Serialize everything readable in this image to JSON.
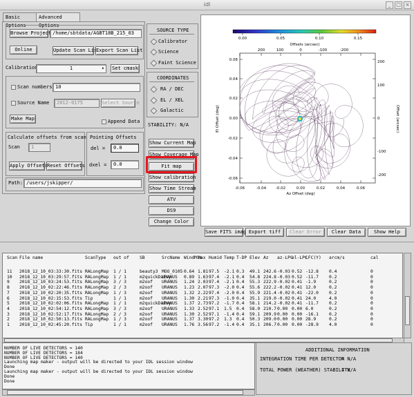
{
  "window": {
    "title": "idl"
  },
  "tabs": [
    {
      "label": "Basic Options"
    },
    {
      "label": "Advanced Options"
    }
  ],
  "top_panel": {
    "browse_projects": "Browse Projects",
    "project_path": "/home/sbtdata/AGBT18B_215_03",
    "online": "Online",
    "update_scan_list": "Update Scan List",
    "export_scan_list": "Export Scan List"
  },
  "calibration": {
    "label": "Calibration",
    "value": "1",
    "set_cmask": "Set cmask"
  },
  "scan_numbers": {
    "label": "Scan numbers",
    "value": "10"
  },
  "source_name": {
    "label": "Source Name",
    "value": "2012-0175",
    "select_button": "Select Source"
  },
  "make_map": "Make Map",
  "append_data": "Append Data",
  "offsets": {
    "calc_title": "Calculate offsets from scan",
    "scan_label": "Scan",
    "scan_value": "1",
    "apply": "Apply Offsets",
    "reset": "Reset Offsets",
    "pointing_title": "Pointing Offsets",
    "del_label": "del =",
    "del_value": "0.0",
    "dxel_label": "dxel =",
    "dxel_value": "0.0"
  },
  "path": {
    "label": "Path:",
    "value": "/users/jskipper/"
  },
  "source_type": {
    "title": "SOURCE TYPE",
    "options": [
      "Calibrator",
      "Science",
      "Faint Science"
    ]
  },
  "coordinates": {
    "title": "COORDINATES",
    "options": [
      "RA / DEC",
      "EL / XEL",
      "Galactic"
    ]
  },
  "stability": "STABILITY:  N/A",
  "right_buttons": [
    "Show Current Map",
    "Show Coverage Map",
    "Fit map",
    "Show calibration",
    "Show Time Stream",
    "ATV",
    "DS9",
    "Change Color"
  ],
  "plot": {
    "colorbar_ticks": [
      "0.00",
      "0.05",
      "0.10",
      "0.15"
    ],
    "top_axis_label": "Offsets (arcsec)",
    "top_ticks": [
      "200",
      "100",
      "0",
      "-100",
      "-200"
    ],
    "bottom_axis_label": "Az Offset (deg)",
    "bottom_ticks": [
      "-0.06",
      "-0.04",
      "-0.02",
      "0.00",
      "0.02",
      "0.04",
      "0.06"
    ],
    "left_axis_label": "El Offset (deg)",
    "left_ticks": [
      "0.06",
      "0.04",
      "0.02",
      "0.00",
      "-0.02",
      "-0.04",
      "-0.06"
    ],
    "right_axis_label": "Offset (arcsec)",
    "right_ticks": [
      "200",
      "100",
      "0",
      "-100",
      "-200"
    ],
    "colors": {
      "trace": "#3a1640",
      "center": "#f2e030",
      "center_ring": "#1eb4c8"
    }
  },
  "plot_buttons": [
    "Save FITS image",
    "Export tiff",
    "Clear Error",
    "Clear Data",
    "Show Help"
  ],
  "table": {
    "headers": [
      "Scan",
      "File name",
      "ScanType",
      "out of",
      "SB",
      "SrcName",
      "WindMin",
      "Max",
      "Humid",
      "Temp",
      "T-DP",
      "Elev",
      "Az",
      "az-LPC",
      "el-LPC",
      "LFC(Y)",
      "arcm/s",
      "cal"
    ],
    "rows": [
      [
        "11",
        "2018_12_10_03:33:30.fits",
        "RALongMap",
        "1 / 1",
        "beauty3",
        "MOO_0105",
        "0.64",
        "1.81",
        "97.5",
        "-2.1",
        "0.3",
        "49.1",
        "242.6",
        "-0.03",
        "0.52",
        "-12.8",
        "0.4",
        "0"
      ],
      [
        "10",
        "2018_12_10_03:29:57.fits",
        "RALongMap",
        "1 / 1",
        "m2quickDaisy",
        "URANUS",
        "0.89",
        "1.63",
        "97.4",
        "-2.1",
        "0.4",
        "54.8",
        "224.8",
        "-0.03",
        "0.52",
        "-11.7",
        "0.2",
        "0"
      ],
      [
        "9",
        "2018_12_10_03:24:53.fits",
        "RALongMap",
        "3 / 3",
        "m2oof",
        "URANUS",
        "1.24",
        "2.03",
        "97.4",
        "-2.1",
        "0.4",
        "55.3",
        "222.9",
        "-0.02",
        "0.41",
        "-1.9",
        "0.2",
        "0"
      ],
      [
        "8",
        "2018_12_10_02:22:46.fits",
        "RALongMap",
        "2 / 3",
        "m2oof",
        "URANUS",
        "1.23",
        "2.07",
        "97.3",
        "-2.0",
        "0.4",
        "55.6",
        "222.2",
        "-0.02",
        "0.41",
        "12.0",
        "0.2",
        "0"
      ],
      [
        "7",
        "2018_12_10_02:20:35.fits",
        "RALongMap",
        "1 / 3",
        "m2oof",
        "URANUS",
        "1.32",
        "2.22",
        "97.4",
        "-2.0",
        "0.4",
        "55.9",
        "221.4",
        "-0.02",
        "0.41",
        "-22.0",
        "0.2",
        "0"
      ],
      [
        "6",
        "2018_12_10_02:15:53.fits",
        "Tip",
        "1 / 1",
        "m2oof",
        "URANUS",
        "1.30",
        "2.21",
        "97.3",
        "-1.0",
        "0.4",
        "35.1",
        "219.0",
        "-0.02",
        "0.41",
        "24.0",
        "4.0",
        "0"
      ],
      [
        "5",
        "2018_12_10_02:02:06.fits",
        "RALongMap",
        "1 / 1",
        "m2quickDaisy",
        "URANUS",
        "1.37",
        "2.73",
        "97.2",
        "-1.7",
        "0.4",
        "58.1",
        "214.2",
        "-0.02",
        "0.41",
        "-11.7",
        "0.2",
        "0"
      ],
      [
        "4",
        "2018_12_10_02:54:12.fits",
        "RALongMap",
        "3 / 3",
        "m2oof",
        "URANUS",
        "1.33",
        "2.52",
        "97.1",
        "1.5",
        "0.4",
        "58.0",
        "210.7",
        "0.00",
        "0.00",
        "6.0",
        "0.2",
        "0"
      ],
      [
        "3",
        "2018_12_10_02:52:17.fits",
        "RALongMap",
        "2 / 3",
        "m2oof",
        "URANUS",
        "1.30",
        "2.52",
        "97.1",
        "-1.4",
        "0.4",
        "59.1",
        "209.9",
        "0.00",
        "0.00",
        "-16.1",
        "0.2",
        "0"
      ],
      [
        "2",
        "2018_12_10_02:50:13.fits",
        "RALongMap",
        "1 / 3",
        "m2oof",
        "URANUS",
        "1.37",
        "3.30",
        "97.2",
        "1.3",
        "0.4",
        "50.3",
        "209.0",
        "0.00",
        "0.00",
        "28.9",
        "0.2",
        "0"
      ],
      [
        "1",
        "2018_12_10_02:45:20.fits",
        "Tip",
        "1 / 1",
        "m2oof",
        "URANUS",
        "1.76",
        "3.56",
        "97.2",
        "-1.4",
        "0.4",
        "35.1",
        "206.7",
        "0.00",
        "0.00",
        "-28.9",
        "4.0",
        "0"
      ]
    ]
  },
  "log_lines": [
    "NUMBER OF LIVE DETECTORS = 140",
    "NUMBER OF LIVE DETECTORS = 184",
    "NUMBER OF LIVE DETECTORS = 140",
    "Launching map maker - output will be directed to your IDL session window",
    "Done",
    "Launching map maker - output will be directed to your IDL session window",
    "Done",
    "Done"
  ],
  "additional_info": {
    "title": "ADDITIONAL INFORMATION",
    "integration_label": "INTEGRATION TIME PER DETECTOR",
    "integration_value": "=   N/A",
    "power_label": "TOTAL POWER (WEATHER) STABILITY",
    "power_value": "=   N/A"
  }
}
